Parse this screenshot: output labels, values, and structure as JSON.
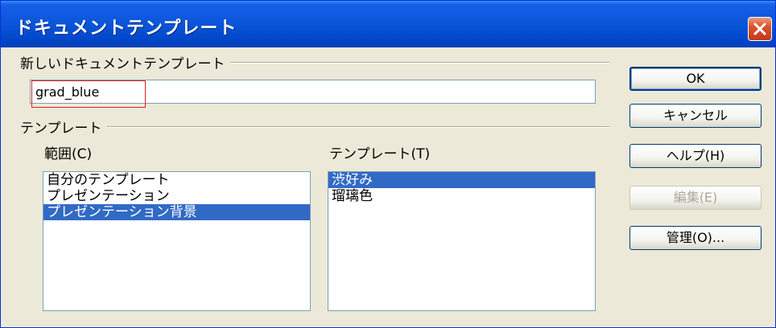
{
  "window": {
    "title": "ドキュメントテンプレート"
  },
  "new_template": {
    "group_label": "新しいドキュメントテンプレート",
    "name_value": "grad_blue"
  },
  "templates": {
    "group_label": "テンプレート",
    "category_label": "範囲(C)",
    "template_label": "テンプレート(T)",
    "categories": [
      {
        "label": "自分のテンプレート",
        "selected": false
      },
      {
        "label": "プレゼンテーション",
        "selected": false
      },
      {
        "label": "プレゼンテーション背景",
        "selected": true
      }
    ],
    "items": [
      {
        "label": "渋好み",
        "selected": true
      },
      {
        "label": "瑠璃色",
        "selected": false
      }
    ]
  },
  "buttons": {
    "ok": "OK",
    "cancel": "キャンセル",
    "help": "ヘルプ(H)",
    "edit": "編集(E)",
    "manage": "管理(O)..."
  },
  "colors": {
    "selection": "#316ac5",
    "titlebar": "#0a55d8",
    "highlight_box": "#e02020"
  }
}
